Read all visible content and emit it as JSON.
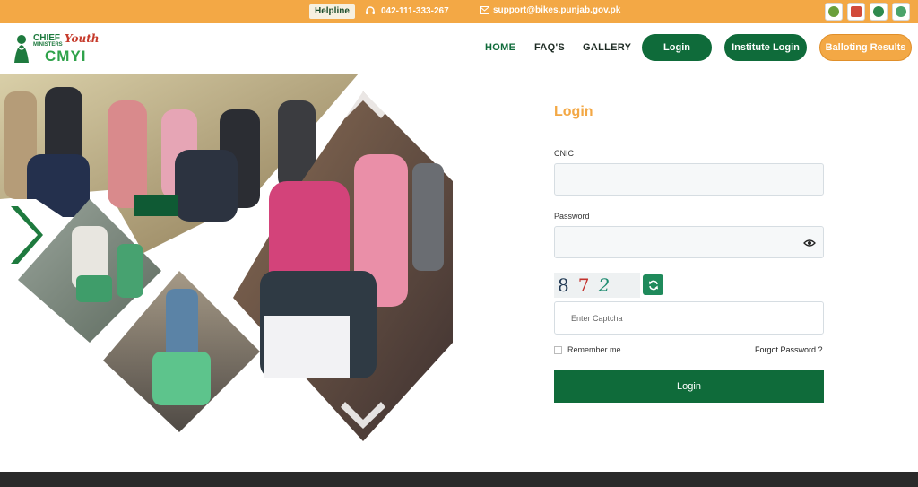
{
  "topbar": {
    "helpline_label": "Helpline",
    "phone": "042-111-333-267",
    "email": "support@bikes.punjab.gov.pk",
    "partner_logos": [
      "punjab-gov-logo",
      "bop-logo",
      "punjab-logo",
      "youth-logo"
    ]
  },
  "header": {
    "logo_text_line1": "CHIEF",
    "logo_text_line2": "MINISTERS",
    "logo_script": "Youth",
    "logo_abbrev": "CMYI",
    "nav": [
      "HOME",
      "FAQ'S",
      "GALLERY"
    ],
    "login_label": "Login",
    "institute_login_label": "Institute Login",
    "balloting_label": "Balloting Results"
  },
  "form": {
    "title": "Login",
    "cnic_label": "CNIC",
    "cnic_value": "",
    "password_label": "Password",
    "password_value": "",
    "captcha_chars": [
      "8",
      "7",
      "2"
    ],
    "captcha_placeholder": "Enter Captcha",
    "remember_label": "Remember me",
    "forgot_label": "Forgot Password ?",
    "submit_label": "Login"
  },
  "colors": {
    "brand_green": "#0f6b3a",
    "brand_orange": "#f3a845"
  }
}
